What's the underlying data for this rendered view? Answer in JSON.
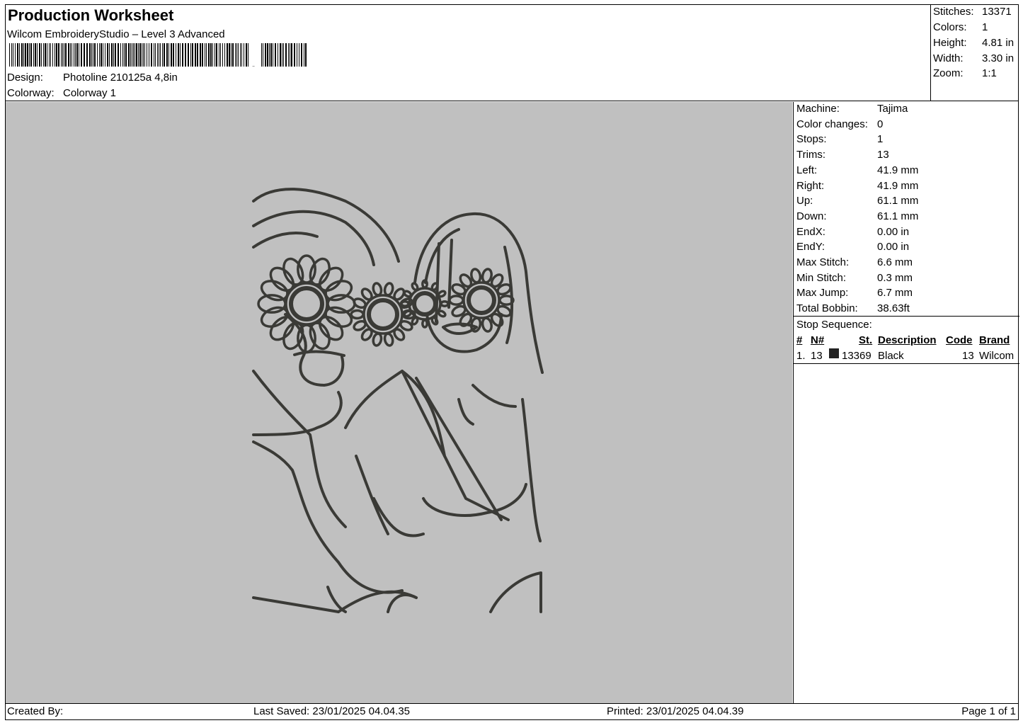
{
  "header": {
    "title": "Production Worksheet",
    "subtitle": "Wilcom EmbroideryStudio – Level 3 Advanced",
    "design_label": "Design:",
    "design_value": "Photoline 210125a 4,8in",
    "colorway_label": "Colorway:",
    "colorway_value": "Colorway 1"
  },
  "summary": [
    {
      "label": "Stitches:",
      "value": "13371"
    },
    {
      "label": "Colors:",
      "value": "1"
    },
    {
      "label": "Height:",
      "value": "4.81 in"
    },
    {
      "label": "Width:",
      "value": "3.30 in"
    },
    {
      "label": "Zoom:",
      "value": "1:1"
    }
  ],
  "machine_info": [
    {
      "label": "Machine:",
      "value": "Tajima"
    },
    {
      "label": "Color changes:",
      "value": "0"
    },
    {
      "label": "Stops:",
      "value": "1"
    },
    {
      "label": "Trims:",
      "value": "13"
    },
    {
      "label": "Left:",
      "value": "41.9 mm"
    },
    {
      "label": "Right:",
      "value": "41.9 mm"
    },
    {
      "label": "Up:",
      "value": "61.1 mm"
    },
    {
      "label": "Down:",
      "value": "61.1 mm"
    },
    {
      "label": "EndX:",
      "value": "0.00 in"
    },
    {
      "label": "EndY:",
      "value": "0.00 in"
    },
    {
      "label": "Max Stitch:",
      "value": "6.6 mm"
    },
    {
      "label": "Min Stitch:",
      "value": "0.3 mm"
    },
    {
      "label": "Max Jump:",
      "value": "6.7 mm"
    },
    {
      "label": "Total Bobbin:",
      "value": "38.63ft"
    }
  ],
  "stop_sequence": {
    "title": "Stop Sequence:",
    "columns": {
      "num": "#",
      "n": "N#",
      "st": "St.",
      "description": "Description",
      "code": "Code",
      "brand": "Brand"
    },
    "rows": [
      {
        "num": "1.",
        "n": "13",
        "st": "13369",
        "description": "Black",
        "code": "13",
        "brand": "Wilcom",
        "color": "#222222"
      }
    ]
  },
  "footer": {
    "created_by": "Created By:",
    "last_saved": "Last Saved: 23/01/2025 04.04.35",
    "printed": "Printed: 23/01/2025 04.04.39",
    "page": "Page 1 of 1"
  },
  "colors": {
    "preview_bg": "#c0c0c0",
    "thread": "#3a3a36"
  },
  "preview_icon": "embroidery-design-preview"
}
